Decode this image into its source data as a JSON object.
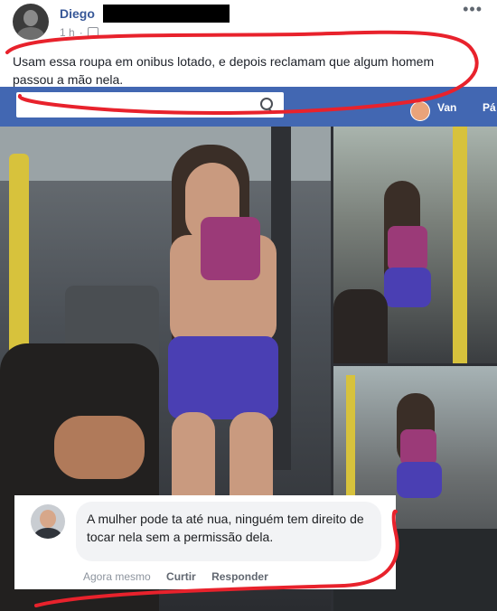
{
  "post": {
    "author": "Diego",
    "time": "1 h",
    "text": "Usam essa roupa em onibus lotado, e depois reclamam que algum homem passou a mão nela."
  },
  "nav": {
    "profile_name": "Van",
    "next_item": "Pá"
  },
  "comment": {
    "text": "A mulher pode ta até nua, ninguém tem direito de tocar nela sem a permissão dela.",
    "time": "Agora mesmo",
    "like": "Curtir",
    "reply": "Responder"
  },
  "colors": {
    "facebook_blue": "#4267b2",
    "link_blue": "#385898",
    "annotation_red": "#e8222c"
  },
  "icons": [
    "more-options-icon",
    "audience-icon",
    "search-icon",
    "avatar"
  ]
}
